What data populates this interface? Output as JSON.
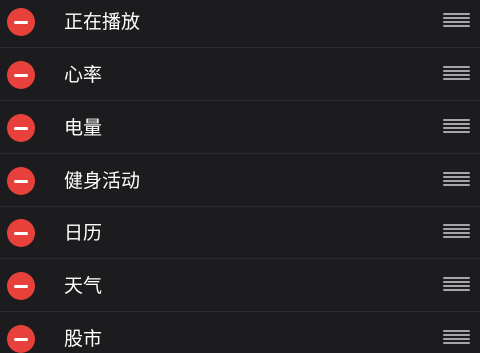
{
  "colors": {
    "background": "#1c1c1e",
    "separator": "#2c2c2e",
    "remove_button": "#e8413b",
    "label_text": "#ffffff",
    "drag_handle": "#a5a5aa"
  },
  "items": [
    {
      "label": "正在播放",
      "remove_icon": "minus-circle-icon",
      "handle_icon": "reorder-handle-icon"
    },
    {
      "label": "心率",
      "remove_icon": "minus-circle-icon",
      "handle_icon": "reorder-handle-icon"
    },
    {
      "label": "电量",
      "remove_icon": "minus-circle-icon",
      "handle_icon": "reorder-handle-icon"
    },
    {
      "label": "健身活动",
      "remove_icon": "minus-circle-icon",
      "handle_icon": "reorder-handle-icon"
    },
    {
      "label": "日历",
      "remove_icon": "minus-circle-icon",
      "handle_icon": "reorder-handle-icon"
    },
    {
      "label": "天气",
      "remove_icon": "minus-circle-icon",
      "handle_icon": "reorder-handle-icon"
    },
    {
      "label": "股市",
      "remove_icon": "minus-circle-icon",
      "handle_icon": "reorder-handle-icon"
    }
  ]
}
